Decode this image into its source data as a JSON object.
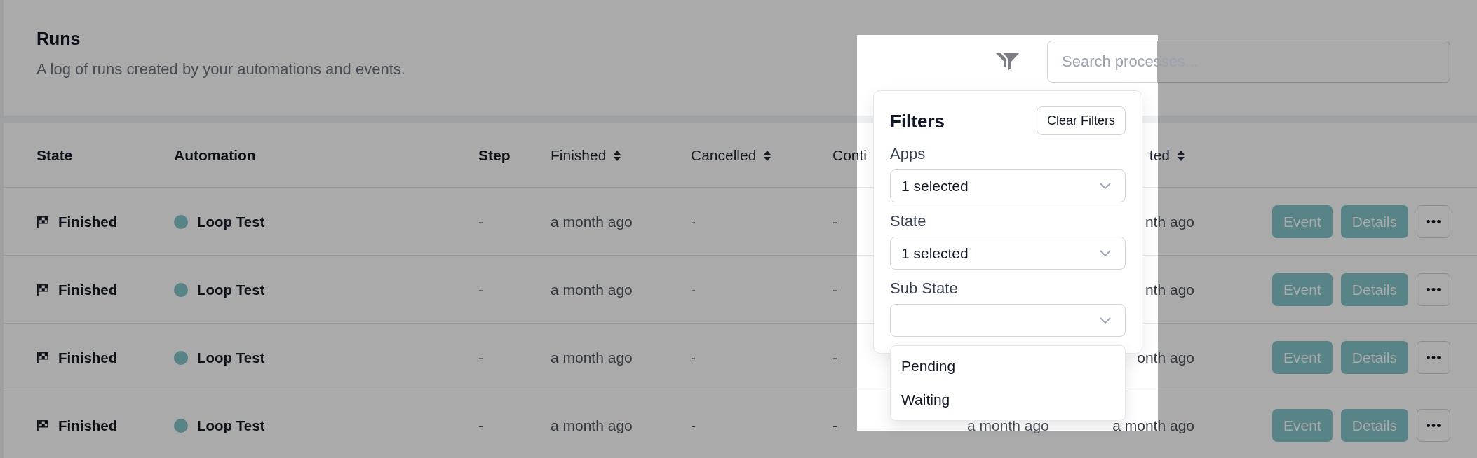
{
  "header": {
    "title": "Runs",
    "subtitle": "A log of runs created by your automations and events."
  },
  "toolbar": {
    "search": {
      "placeholder": "Search processes..."
    }
  },
  "table": {
    "columns": [
      {
        "label": "State",
        "kind": "plain"
      },
      {
        "label": "Automation",
        "kind": "plain"
      },
      {
        "label": "Step",
        "kind": "plain"
      },
      {
        "label": "Finished",
        "kind": "sort",
        "sortable": true
      },
      {
        "label": "Cancelled",
        "kind": "sort",
        "sortable": true
      },
      {
        "label": "Conti",
        "kind": "sort",
        "sortable": false
      },
      null,
      {
        "label": "ted",
        "kind": "sort",
        "sortable": true
      }
    ],
    "rows": [
      {
        "cells": [
          "Finished",
          "Loop Test",
          "-",
          "a month ago",
          "-",
          "-",
          "",
          "nth ago"
        ],
        "actions": [
          "Event",
          "Details"
        ]
      },
      {
        "cells": [
          "Finished",
          "Loop Test",
          "-",
          "a month ago",
          "-",
          "-",
          "",
          "nth ago"
        ],
        "actions": [
          "Event",
          "Details"
        ]
      },
      {
        "cells": [
          "Finished",
          "Loop Test",
          "-",
          "a month ago",
          "-",
          "-",
          "",
          "onth ago"
        ],
        "actions": [
          "Event",
          "Details"
        ]
      },
      {
        "cells": [
          "Finished",
          "Loop Test",
          "-",
          "a month ago",
          "-",
          "-",
          "a month ago",
          "a month ago"
        ],
        "actions": [
          "Event",
          "Details"
        ]
      }
    ]
  },
  "filters": {
    "title": "Filters",
    "clear_button": "Clear Filters",
    "fields": [
      {
        "label": "Apps",
        "value": "1 selected"
      },
      {
        "label": "State",
        "value": "1 selected"
      },
      {
        "label": "Sub State",
        "options": [
          "Pending",
          "Waiting"
        ]
      }
    ]
  },
  "tour_overlay": {
    "on": true
  }
}
